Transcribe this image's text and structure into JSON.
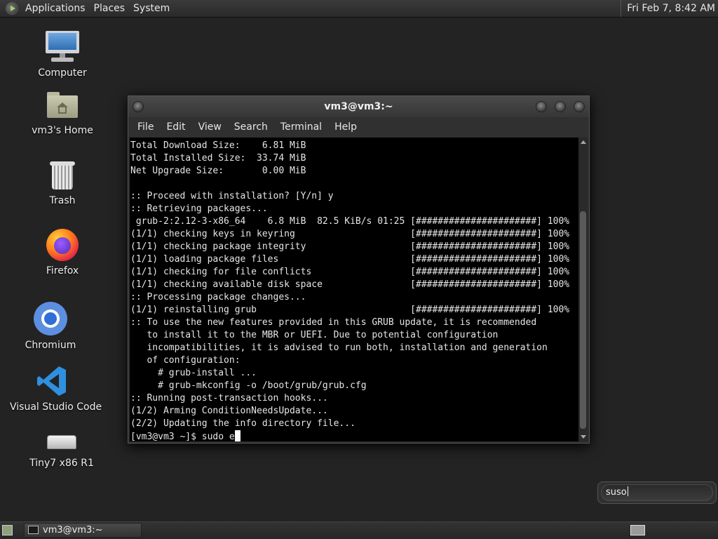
{
  "top_panel": {
    "menus": [
      "Applications",
      "Places",
      "System"
    ],
    "clock": "Fri Feb  7,  8:42 AM"
  },
  "desktop": {
    "icons": [
      {
        "label": "Computer",
        "icon": "computer-icon"
      },
      {
        "label": "vm3's Home",
        "icon": "home-folder-icon"
      },
      {
        "label": "Trash",
        "icon": "trash-icon"
      },
      {
        "label": "Firefox",
        "icon": "firefox-icon"
      },
      {
        "label": "Chromium",
        "icon": "chromium-icon"
      },
      {
        "label": "Visual Studio Code",
        "icon": "vscode-icon"
      },
      {
        "label": "Tiny7 x86 R1",
        "icon": "drive-icon"
      }
    ]
  },
  "terminal": {
    "title": "vm3@vm3:~",
    "menus": [
      "File",
      "Edit",
      "View",
      "Search",
      "Terminal",
      "Help"
    ],
    "lines": [
      "Total Download Size:    6.81 MiB",
      "Total Installed Size:  33.74 MiB",
      "Net Upgrade Size:       0.00 MiB",
      "",
      ":: Proceed with installation? [Y/n] y",
      ":: Retrieving packages...",
      " grub-2:2.12-3-x86_64    6.8 MiB  82.5 KiB/s 01:25 [######################] 100%",
      "(1/1) checking keys in keyring                     [######################] 100%",
      "(1/1) checking package integrity                   [######################] 100%",
      "(1/1) loading package files                        [######################] 100%",
      "(1/1) checking for file conflicts                  [######################] 100%",
      "(1/1) checking available disk space                [######################] 100%",
      ":: Processing package changes...",
      "(1/1) reinstalling grub                            [######################] 100%",
      ":: To use the new features provided in this GRUB update, it is recommended",
      "   to install it to the MBR or UEFI. Due to potential configuration",
      "   incompatibilities, it is advised to run both, installation and generation",
      "   of configuration:",
      "     # grub-install ...",
      "     # grub-mkconfig -o /boot/grub/grub.cfg",
      ":: Running post-transaction hooks...",
      "(1/2) Arming ConditionNeedsUpdate...",
      "(2/2) Updating the info directory file..."
    ],
    "prompt": "[vm3@vm3 ~]$ sudo e"
  },
  "quick_input": {
    "value": "suso"
  },
  "taskbar": {
    "task_label": "vm3@vm3:~"
  }
}
